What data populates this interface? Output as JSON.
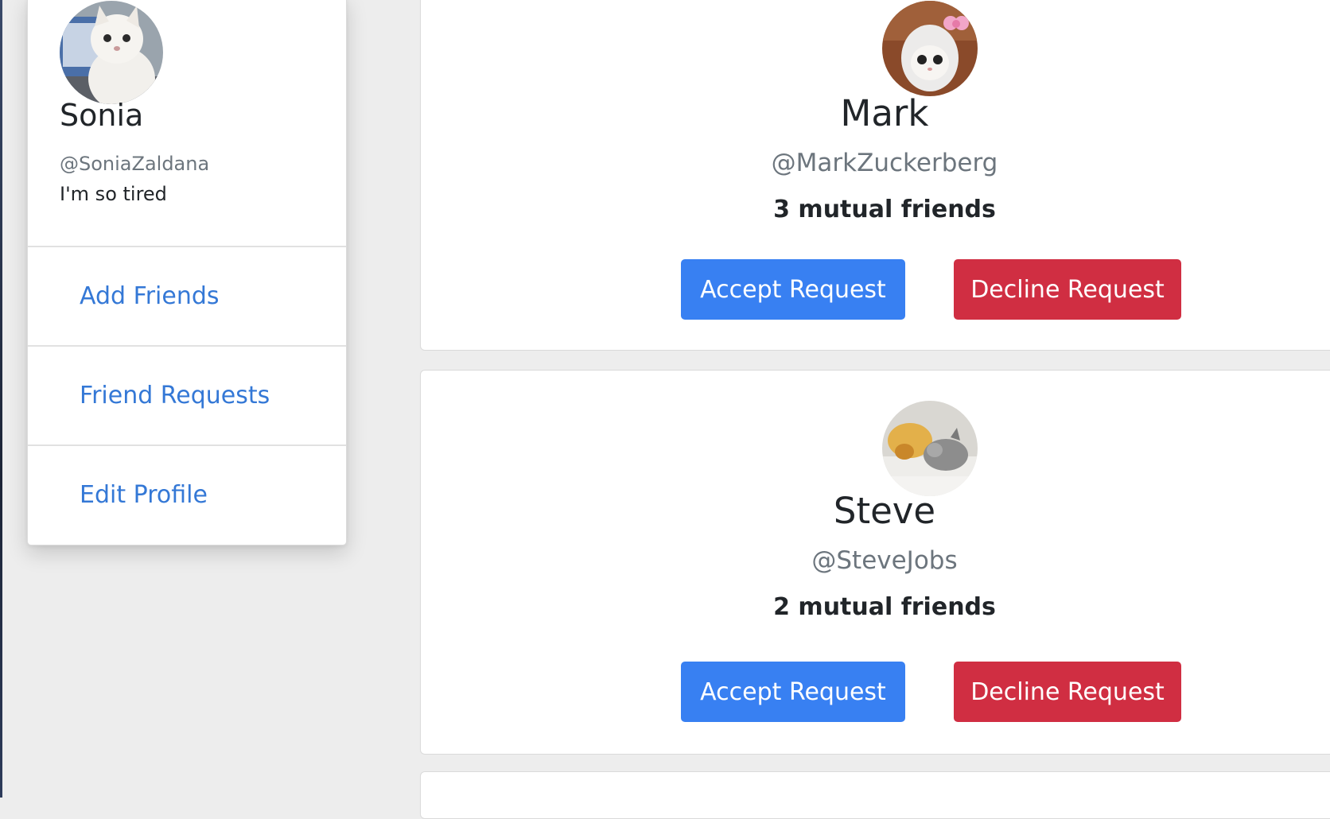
{
  "profile": {
    "name": "Sonia",
    "handle": "@SoniaZaldana",
    "bio": "I'm so tired"
  },
  "nav": [
    {
      "label": "Add Friends"
    },
    {
      "label": "Friend Requests"
    },
    {
      "label": "Edit Profile"
    }
  ],
  "requests": [
    {
      "name": "Mark",
      "handle": "@MarkZuckerberg",
      "mutual": "3 mutual friends",
      "accept_label": "Accept Request",
      "decline_label": "Decline Request"
    },
    {
      "name": "Steve",
      "handle": "@SteveJobs",
      "mutual": "2 mutual friends",
      "accept_label": "Accept Request",
      "decline_label": "Decline Request"
    }
  ],
  "colors": {
    "link": "#3478d6",
    "accept": "#3880f2",
    "decline": "#d02e42",
    "background": "#ededed"
  }
}
